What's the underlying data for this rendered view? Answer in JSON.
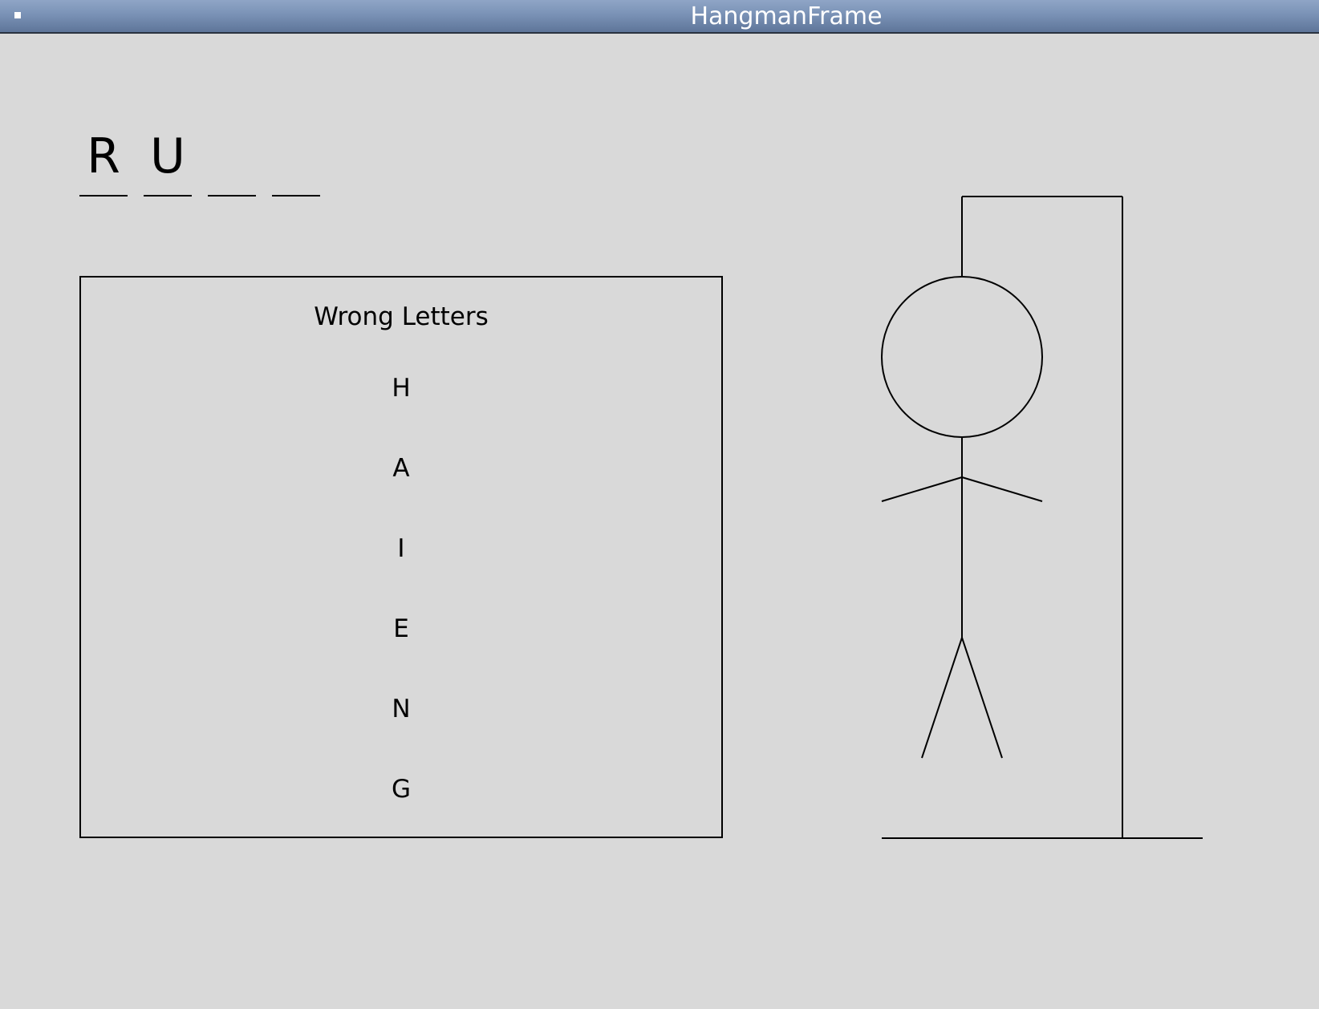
{
  "window": {
    "title": "HangmanFrame"
  },
  "word": {
    "letters": [
      "R",
      "U",
      "",
      ""
    ]
  },
  "wrong_letters": {
    "title": "Wrong Letters",
    "letters": [
      "H",
      "A",
      "I",
      "E",
      "N",
      "G"
    ]
  }
}
